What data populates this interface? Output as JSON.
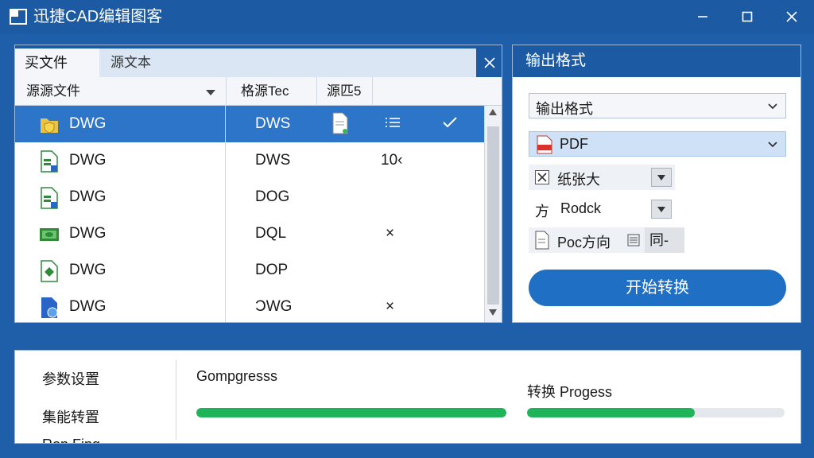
{
  "window": {
    "title": "迅捷CAD编辑图客",
    "icons": [
      "app-logo",
      "minimize-icon",
      "maximize-icon",
      "close-icon"
    ]
  },
  "file_panel": {
    "tab_active": "买文件",
    "tab_inactive": "源文本",
    "columns": [
      "源源文件",
      "格源Tec",
      "源匹5"
    ],
    "rows": [
      {
        "name": "DWG",
        "output": "DWS",
        "extra": "",
        "icon": "folder-shield-icon",
        "selected": true
      },
      {
        "name": "DWG",
        "output": "DWS",
        "extra": "10‹",
        "icon": "cad-file-icon",
        "selected": false
      },
      {
        "name": "DWG",
        "output": "DOG",
        "extra": "",
        "icon": "cad-file-icon",
        "selected": false
      },
      {
        "name": "DWG",
        "output": "DQL",
        "extra": "×",
        "icon": "image-file-icon",
        "selected": false
      },
      {
        "name": "DWG",
        "output": "DOP",
        "extra": "",
        "icon": "diamond-file-icon",
        "selected": false
      },
      {
        "name": "DWG",
        "output": "ƆWG",
        "extra": "×",
        "icon": "blue-doc-icon",
        "selected": false
      }
    ]
  },
  "output_panel": {
    "header": "输出格式",
    "format_select": "输出格式",
    "format_value": "PDF",
    "option1": "纸张大",
    "option2_prefix": "方",
    "option2": "Rodck",
    "option3": "Poc方向",
    "option3_tail": "同-",
    "start_button": "开始转换"
  },
  "bottom_panel": {
    "links": [
      "参数设置",
      "集能转置",
      "Ron Fing ..."
    ],
    "progress1_label": "Gompgresss",
    "progress2_label": "转换 Progess",
    "progress1_value": 1.0,
    "progress2_value": 0.65
  },
  "colors": {
    "accent": "#1c5aa3",
    "selected_row": "#2c75c9",
    "progress": "#1fb45a"
  }
}
